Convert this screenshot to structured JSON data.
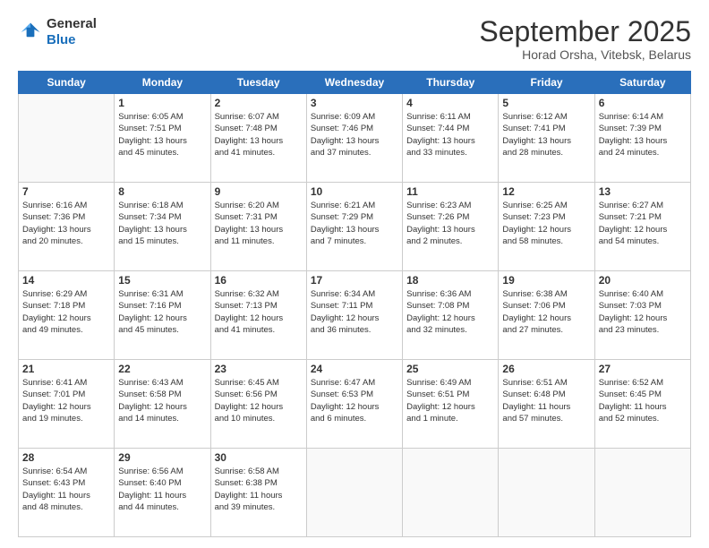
{
  "header": {
    "logo_general": "General",
    "logo_blue": "Blue",
    "month_title": "September 2025",
    "location": "Horad Orsha, Vitebsk, Belarus"
  },
  "days_of_week": [
    "Sunday",
    "Monday",
    "Tuesday",
    "Wednesday",
    "Thursday",
    "Friday",
    "Saturday"
  ],
  "weeks": [
    [
      {
        "day": "",
        "info": ""
      },
      {
        "day": "1",
        "info": "Sunrise: 6:05 AM\nSunset: 7:51 PM\nDaylight: 13 hours\nand 45 minutes."
      },
      {
        "day": "2",
        "info": "Sunrise: 6:07 AM\nSunset: 7:48 PM\nDaylight: 13 hours\nand 41 minutes."
      },
      {
        "day": "3",
        "info": "Sunrise: 6:09 AM\nSunset: 7:46 PM\nDaylight: 13 hours\nand 37 minutes."
      },
      {
        "day": "4",
        "info": "Sunrise: 6:11 AM\nSunset: 7:44 PM\nDaylight: 13 hours\nand 33 minutes."
      },
      {
        "day": "5",
        "info": "Sunrise: 6:12 AM\nSunset: 7:41 PM\nDaylight: 13 hours\nand 28 minutes."
      },
      {
        "day": "6",
        "info": "Sunrise: 6:14 AM\nSunset: 7:39 PM\nDaylight: 13 hours\nand 24 minutes."
      }
    ],
    [
      {
        "day": "7",
        "info": "Sunrise: 6:16 AM\nSunset: 7:36 PM\nDaylight: 13 hours\nand 20 minutes."
      },
      {
        "day": "8",
        "info": "Sunrise: 6:18 AM\nSunset: 7:34 PM\nDaylight: 13 hours\nand 15 minutes."
      },
      {
        "day": "9",
        "info": "Sunrise: 6:20 AM\nSunset: 7:31 PM\nDaylight: 13 hours\nand 11 minutes."
      },
      {
        "day": "10",
        "info": "Sunrise: 6:21 AM\nSunset: 7:29 PM\nDaylight: 13 hours\nand 7 minutes."
      },
      {
        "day": "11",
        "info": "Sunrise: 6:23 AM\nSunset: 7:26 PM\nDaylight: 13 hours\nand 2 minutes."
      },
      {
        "day": "12",
        "info": "Sunrise: 6:25 AM\nSunset: 7:23 PM\nDaylight: 12 hours\nand 58 minutes."
      },
      {
        "day": "13",
        "info": "Sunrise: 6:27 AM\nSunset: 7:21 PM\nDaylight: 12 hours\nand 54 minutes."
      }
    ],
    [
      {
        "day": "14",
        "info": "Sunrise: 6:29 AM\nSunset: 7:18 PM\nDaylight: 12 hours\nand 49 minutes."
      },
      {
        "day": "15",
        "info": "Sunrise: 6:31 AM\nSunset: 7:16 PM\nDaylight: 12 hours\nand 45 minutes."
      },
      {
        "day": "16",
        "info": "Sunrise: 6:32 AM\nSunset: 7:13 PM\nDaylight: 12 hours\nand 41 minutes."
      },
      {
        "day": "17",
        "info": "Sunrise: 6:34 AM\nSunset: 7:11 PM\nDaylight: 12 hours\nand 36 minutes."
      },
      {
        "day": "18",
        "info": "Sunrise: 6:36 AM\nSunset: 7:08 PM\nDaylight: 12 hours\nand 32 minutes."
      },
      {
        "day": "19",
        "info": "Sunrise: 6:38 AM\nSunset: 7:06 PM\nDaylight: 12 hours\nand 27 minutes."
      },
      {
        "day": "20",
        "info": "Sunrise: 6:40 AM\nSunset: 7:03 PM\nDaylight: 12 hours\nand 23 minutes."
      }
    ],
    [
      {
        "day": "21",
        "info": "Sunrise: 6:41 AM\nSunset: 7:01 PM\nDaylight: 12 hours\nand 19 minutes."
      },
      {
        "day": "22",
        "info": "Sunrise: 6:43 AM\nSunset: 6:58 PM\nDaylight: 12 hours\nand 14 minutes."
      },
      {
        "day": "23",
        "info": "Sunrise: 6:45 AM\nSunset: 6:56 PM\nDaylight: 12 hours\nand 10 minutes."
      },
      {
        "day": "24",
        "info": "Sunrise: 6:47 AM\nSunset: 6:53 PM\nDaylight: 12 hours\nand 6 minutes."
      },
      {
        "day": "25",
        "info": "Sunrise: 6:49 AM\nSunset: 6:51 PM\nDaylight: 12 hours\nand 1 minute."
      },
      {
        "day": "26",
        "info": "Sunrise: 6:51 AM\nSunset: 6:48 PM\nDaylight: 11 hours\nand 57 minutes."
      },
      {
        "day": "27",
        "info": "Sunrise: 6:52 AM\nSunset: 6:45 PM\nDaylight: 11 hours\nand 52 minutes."
      }
    ],
    [
      {
        "day": "28",
        "info": "Sunrise: 6:54 AM\nSunset: 6:43 PM\nDaylight: 11 hours\nand 48 minutes."
      },
      {
        "day": "29",
        "info": "Sunrise: 6:56 AM\nSunset: 6:40 PM\nDaylight: 11 hours\nand 44 minutes."
      },
      {
        "day": "30",
        "info": "Sunrise: 6:58 AM\nSunset: 6:38 PM\nDaylight: 11 hours\nand 39 minutes."
      },
      {
        "day": "",
        "info": ""
      },
      {
        "day": "",
        "info": ""
      },
      {
        "day": "",
        "info": ""
      },
      {
        "day": "",
        "info": ""
      }
    ]
  ]
}
